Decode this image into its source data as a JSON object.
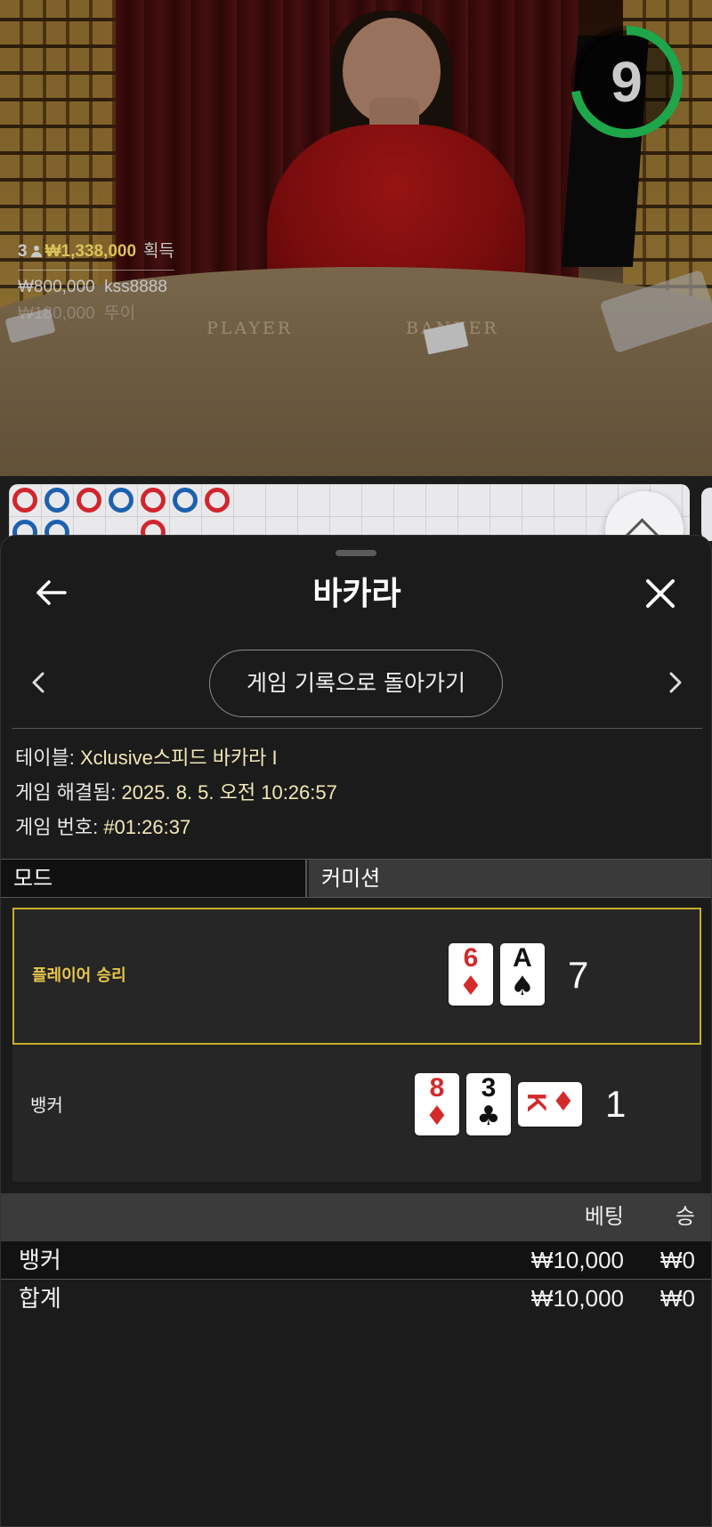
{
  "video": {
    "table_player_text": "PLAYER",
    "table_banker_text": "BANKER",
    "timer": {
      "value": "9",
      "fraction_remaining": 0.72,
      "color": "#1fa64a"
    },
    "winners": {
      "count": "3",
      "amount": "₩1,338,000",
      "suffix": "획득",
      "rows": [
        "₩800,000  kss8888",
        "₩180,000  뚜이"
      ]
    }
  },
  "roadmap": {
    "colors": {
      "banker": "#d0262e",
      "player": "#1e5fb0"
    }
  },
  "sheet": {
    "title": "바카라",
    "back_label": "게임 기록으로 돌아가기",
    "info": {
      "table_label": "테이블: ",
      "table_value": "Xclusive스피드 바카라 I",
      "resolved_label": "게임 해결됨: ",
      "resolved_value": "2025. 8. 5. 오전 10:26:57",
      "number_label": "게임 번호: ",
      "number_value": "#01:26:37"
    },
    "mode": {
      "left": "모드",
      "right": "커미션"
    },
    "player": {
      "label": "플레이어 승리",
      "cards": [
        {
          "rank": "6",
          "suit": "♦",
          "color": "red"
        },
        {
          "rank": "A",
          "suit": "♠",
          "color": "black"
        }
      ],
      "total": "7"
    },
    "banker": {
      "label": "뱅커",
      "cards": [
        {
          "rank": "8",
          "suit": "♦",
          "color": "red"
        },
        {
          "rank": "3",
          "suit": "♣",
          "color": "black"
        },
        {
          "rank": "K",
          "suit": "♦",
          "color": "red"
        }
      ],
      "total": "1"
    },
    "bets": {
      "header": {
        "bet": "베팅",
        "win": "승"
      },
      "rows": [
        {
          "name": "뱅커",
          "bet": "₩10,000",
          "win": "₩0"
        },
        {
          "name": "합계",
          "bet": "₩10,000",
          "win": "₩0"
        }
      ]
    }
  }
}
